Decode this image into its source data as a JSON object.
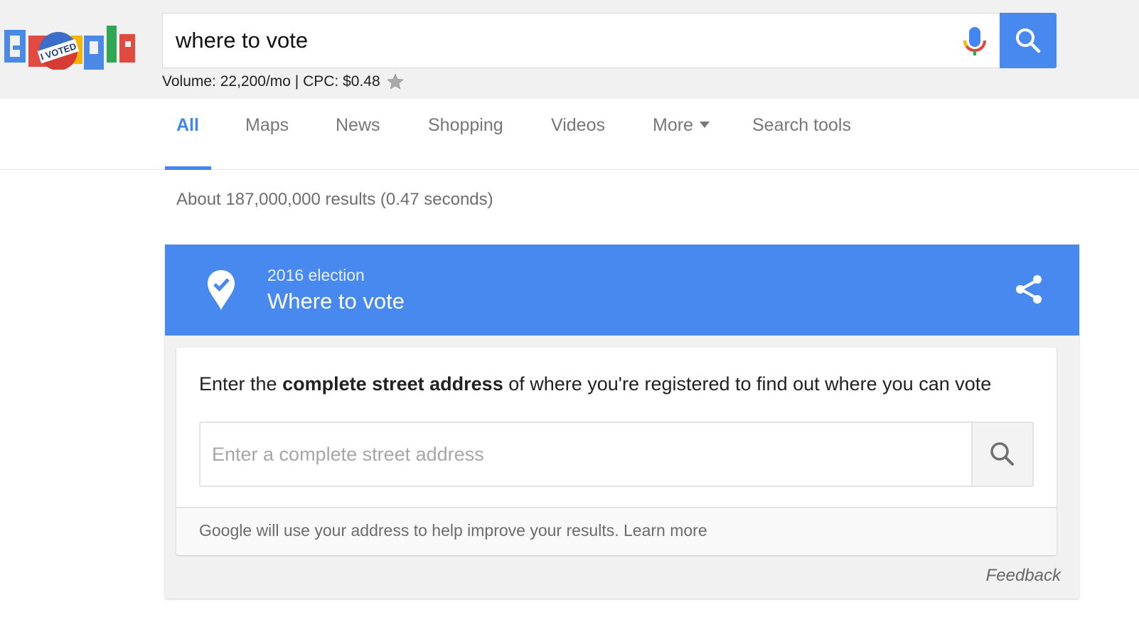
{
  "header": {
    "logo_alt": "Google",
    "logo_badge": "I VOTED",
    "search_query": "where to vote",
    "volume_text": "Volume: 22,200/mo | CPC: $0.48",
    "icons": {
      "mic": "microphone-icon",
      "search": "search-icon",
      "star": "star-icon"
    }
  },
  "tabs": [
    {
      "label": "All",
      "active": true
    },
    {
      "label": "Maps"
    },
    {
      "label": "News"
    },
    {
      "label": "Shopping"
    },
    {
      "label": "Videos"
    },
    {
      "label": "More",
      "has_dropdown": true
    },
    {
      "label": "Search tools"
    }
  ],
  "results": {
    "stats": "About 187,000,000 results (0.47 seconds)"
  },
  "card": {
    "subtitle": "2016 election",
    "title": "Where to vote",
    "instruction_prefix": "Enter the ",
    "instruction_bold": "complete street address",
    "instruction_suffix": " of where you're registered to find out where you can vote",
    "address_placeholder": "Enter a complete street address",
    "address_value": "",
    "disclaimer": "Google will use your address to help improve your results. ",
    "learn_more": "Learn more",
    "feedback": "Feedback",
    "icons": {
      "pin": "location-check-icon",
      "share": "share-icon",
      "address_search": "search-icon"
    }
  },
  "colors": {
    "accent_blue": "#4889f0",
    "tab_active": "#4285f4",
    "header_bg": "#f1f1f1"
  }
}
